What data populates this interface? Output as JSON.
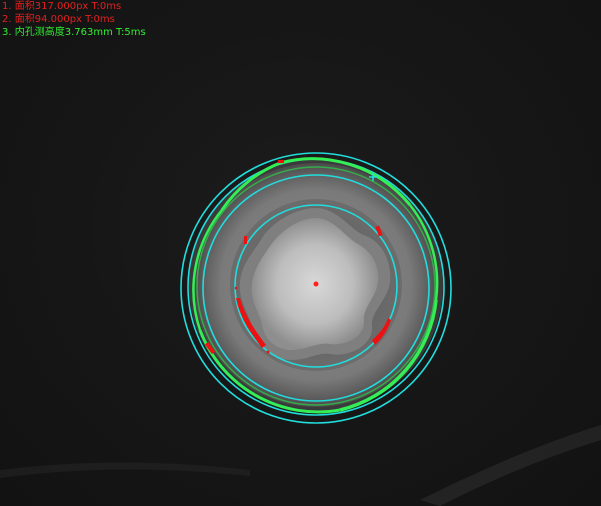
{
  "measurements": [
    {
      "text": "1. 面积317.000px  T:0ms",
      "color": "#e02020"
    },
    {
      "text": "2. 面积94.000px  T:0ms",
      "color": "#e02020"
    },
    {
      "text": "3. 内孔测高度3.763mm  T:5ms",
      "color": "#33ee33"
    }
  ],
  "colors": {
    "fit_circle": "#22dddd",
    "edge_contour": "#33ee55",
    "defect": "#ee1111",
    "center": "#ff2020"
  },
  "icons": {
    "center_marker": "center-dot-icon",
    "crosshair": "crosshair-icon"
  }
}
